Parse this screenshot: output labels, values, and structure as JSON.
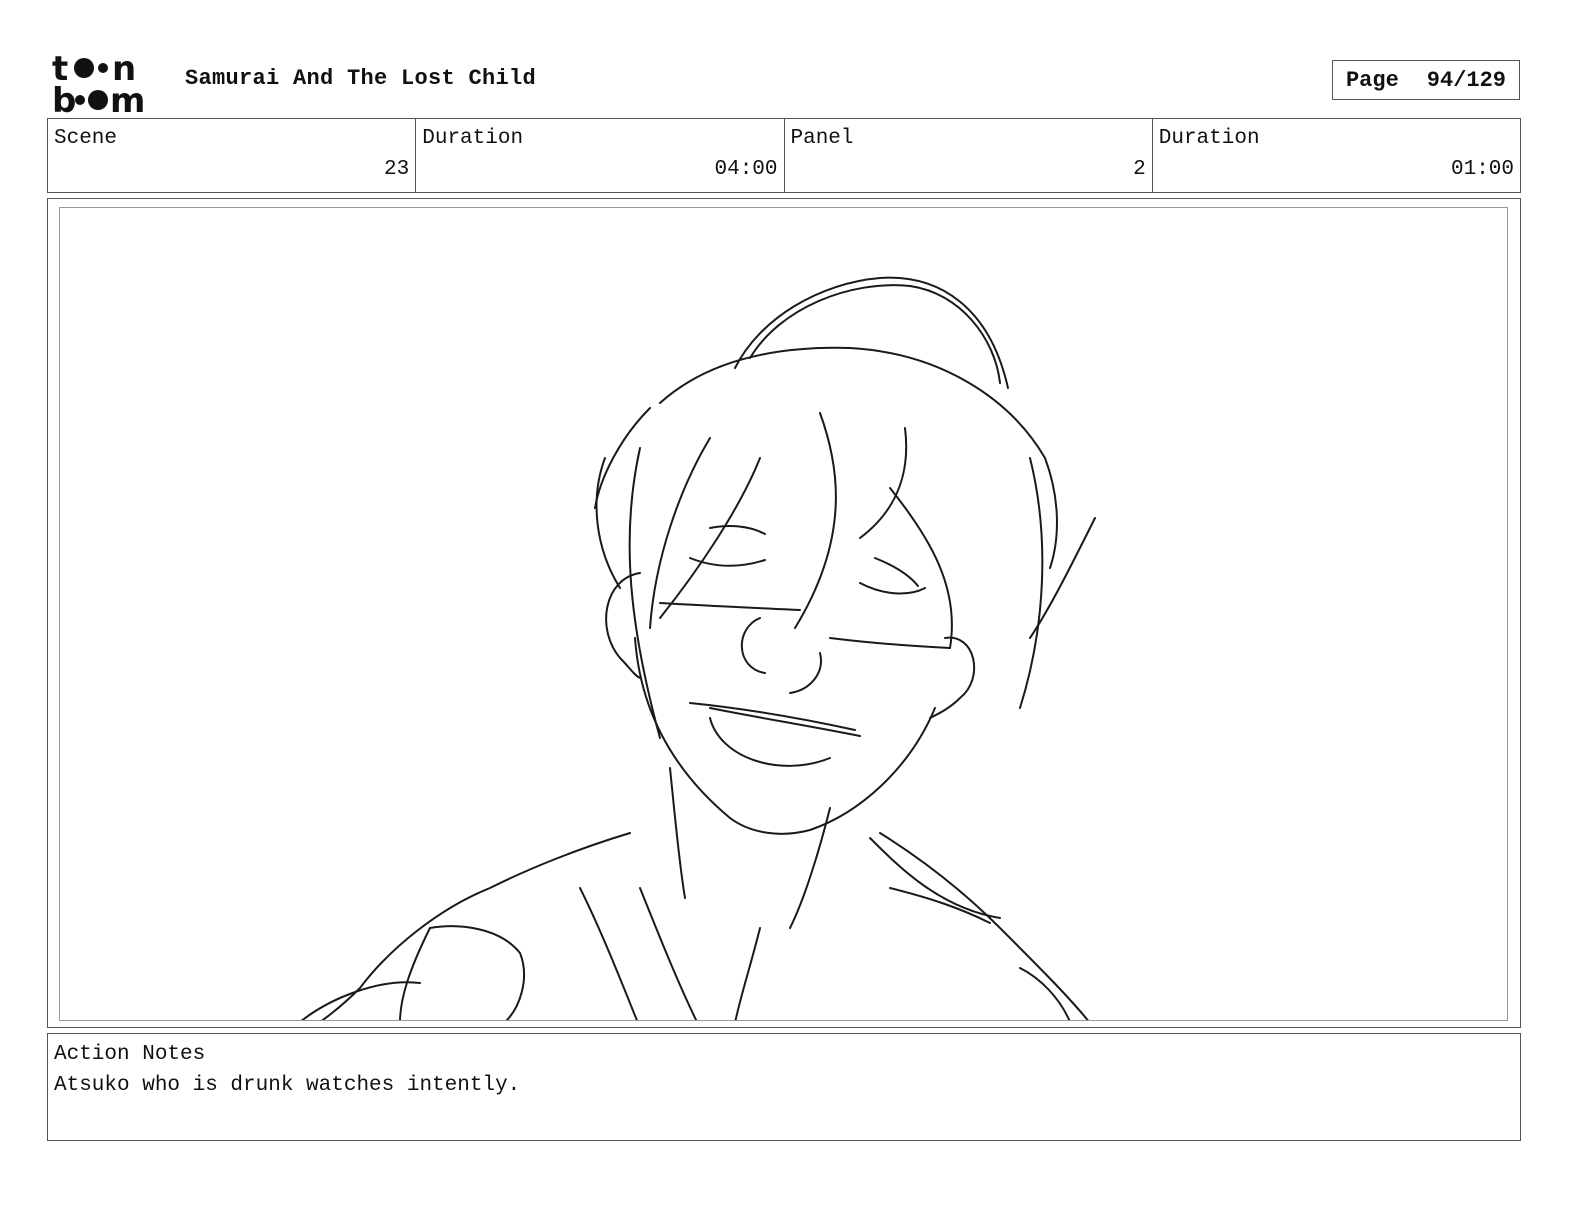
{
  "header": {
    "logo_text": "toon boom",
    "title": "Samurai And The Lost Child",
    "page_label": "Page",
    "page_value": "94/129"
  },
  "info": {
    "scene_label": "Scene",
    "scene_value": "23",
    "scene_duration_label": "Duration",
    "scene_duration_value": "04:00",
    "panel_label": "Panel",
    "panel_value": "2",
    "panel_duration_label": "Duration",
    "panel_duration_value": "01:00"
  },
  "notes": {
    "label": "Action Notes",
    "text": "Atsuko who is drunk watches intently."
  }
}
